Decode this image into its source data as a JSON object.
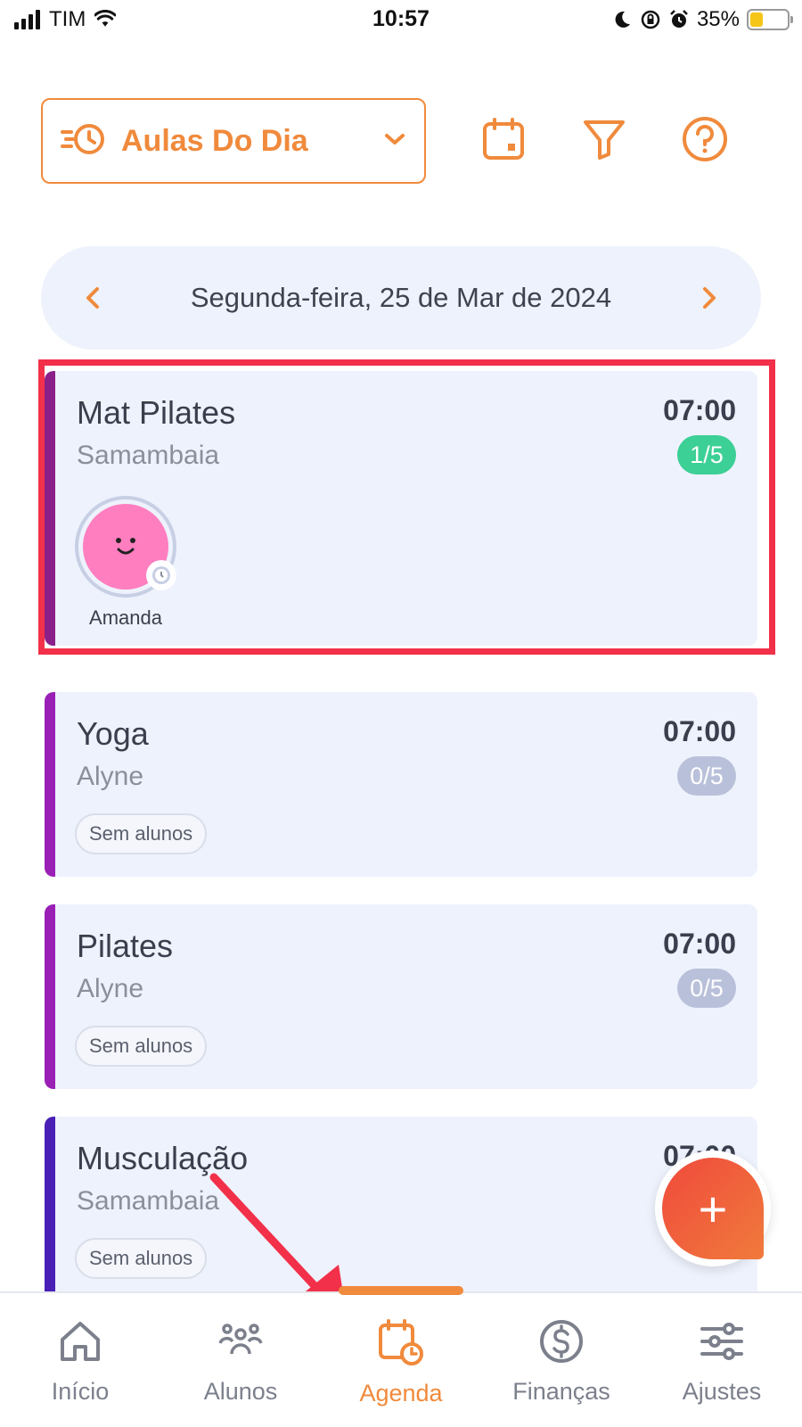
{
  "status_bar": {
    "carrier": "TIM",
    "time": "10:57",
    "battery_percent": "35%",
    "battery_level": 0.35
  },
  "header": {
    "view_selector_label": "Aulas Do Dia",
    "icons": [
      "calendar-icon",
      "filter-icon",
      "help-icon"
    ]
  },
  "date_nav": {
    "date": "Segunda-feira, 25 de Mar de 2024"
  },
  "classes": [
    {
      "title": "Mat Pilates",
      "location": "Samambaia",
      "time": "07:00",
      "count": "1/5",
      "count_status": "green",
      "accent_color": "#8a1f8a",
      "students": [
        {
          "name": "Amanda",
          "avatar_color": "#ff7ec0"
        }
      ]
    },
    {
      "title": "Yoga",
      "location": "Alyne",
      "time": "07:00",
      "count": "0/5",
      "count_status": "gray",
      "accent_color": "#9a1fb5",
      "empty_label": "Sem alunos"
    },
    {
      "title": "Pilates",
      "location": "Alyne",
      "time": "07:00",
      "count": "0/5",
      "count_status": "gray",
      "accent_color": "#9a1fb5",
      "empty_label": "Sem alunos"
    },
    {
      "title": "Musculação",
      "location": "Samambaia",
      "time": "07:00",
      "accent_color": "#4a1fb5",
      "empty_label": "Sem alunos"
    }
  ],
  "fab": {
    "symbol": "+"
  },
  "bottom_nav": [
    {
      "label": "Início",
      "icon": "home-icon",
      "active": false
    },
    {
      "label": "Alunos",
      "icon": "students-icon",
      "active": false
    },
    {
      "label": "Agenda",
      "icon": "agenda-icon",
      "active": true
    },
    {
      "label": "Finanças",
      "icon": "finance-icon",
      "active": false
    },
    {
      "label": "Ajustes",
      "icon": "settings-icon",
      "active": false
    }
  ],
  "colors": {
    "brand_orange": "#f08a3c",
    "card_bg": "#eef2fc",
    "highlight_red": "#f2304a"
  }
}
